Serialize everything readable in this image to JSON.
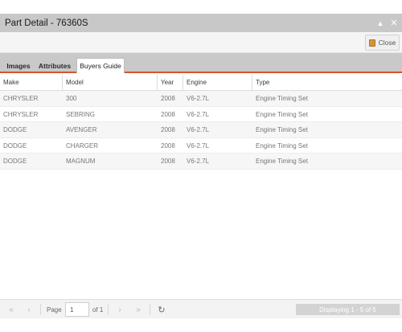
{
  "window": {
    "title": "Part Detail - 76360S",
    "collapse_icon": "chevron-up-icon",
    "close_icon": "close-icon"
  },
  "toolbar": {
    "close_label": "Close",
    "close_icon": "door-icon"
  },
  "tabs": [
    {
      "label": "Images",
      "active": false
    },
    {
      "label": "Attributes",
      "active": false
    },
    {
      "label": "Buyers Guide",
      "active": true
    }
  ],
  "grid": {
    "columns": [
      "Make",
      "Model",
      "Year",
      "Engine",
      "Type"
    ],
    "rows": [
      [
        "CHRYSLER",
        "300",
        "2008",
        "V6-2.7L",
        "Engine Timing Set"
      ],
      [
        "CHRYSLER",
        "SEBRING",
        "2008",
        "V6-2.7L",
        "Engine Timing Set"
      ],
      [
        "DODGE",
        "AVENGER",
        "2008",
        "V6-2.7L",
        "Engine Timing Set"
      ],
      [
        "DODGE",
        "CHARGER",
        "2008",
        "V6-2.7L",
        "Engine Timing Set"
      ],
      [
        "DODGE",
        "MAGNUM",
        "2008",
        "V6-2.7L",
        "Engine Timing Set"
      ]
    ]
  },
  "pager": {
    "page_label": "Page",
    "page_value": "1",
    "of_label": "of 1",
    "display_text": "Displaying 1 - 5 of 5"
  },
  "colors": {
    "accent": "#d4552c",
    "titlebar": "#c8c8c8"
  }
}
